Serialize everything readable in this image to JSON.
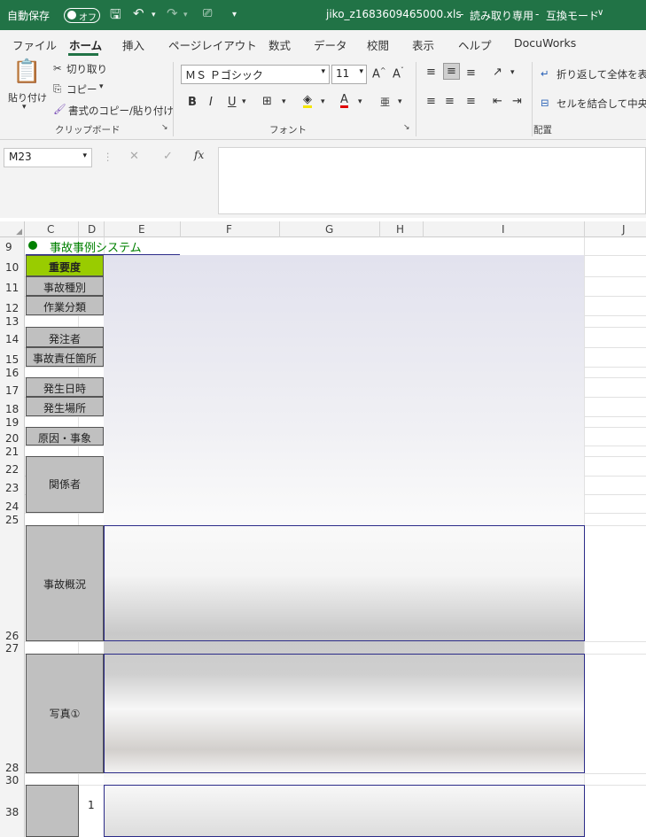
{
  "titlebar": {
    "autosave_label": "自動保存",
    "autosave_state": "オフ",
    "file_title": "jiko_z1683609465000.xls",
    "readonly": "読み取り専用",
    "compat": "互換モード",
    "sep1": "-",
    "sep2": "-",
    "compat_dropdown": "∨"
  },
  "tabs": [
    "ファイル",
    "ホーム",
    "挿入",
    "ページレイアウト",
    "数式",
    "データ",
    "校閲",
    "表示",
    "ヘルプ",
    "DocuWorks"
  ],
  "active_tab": "ホーム",
  "ribbon": {
    "clipboard": {
      "paste": "貼り付け",
      "cut": "切り取り",
      "copy": "コピー",
      "format_painter": "書式のコピー/貼り付け",
      "group": "クリップボード"
    },
    "font": {
      "name": "ＭＳ Ｐゴシック",
      "size": "11",
      "bold": "B",
      "italic": "I",
      "underline": "U",
      "group": "フォント"
    },
    "alignment": {
      "wrap": "折り返して全体を表示",
      "merge": "セルを結合して中央揃",
      "group": "配置"
    }
  },
  "formula_bar": {
    "namebox": "M23",
    "fx": "fx",
    "value": ""
  },
  "columns": [
    "C",
    "D",
    "E",
    "F",
    "G",
    "H",
    "I",
    "J"
  ],
  "rows": [
    "9",
    "10",
    "11",
    "12",
    "13",
    "14",
    "15",
    "16",
    "17",
    "18",
    "19",
    "20",
    "21",
    "22",
    "23",
    "24",
    "25",
    "26",
    "27",
    "28",
    "30",
    "38"
  ],
  "sheet": {
    "title": "事故事例システム",
    "labels": {
      "severity": "重要度",
      "accident_type": "事故種別",
      "work_class": "作業分類",
      "orderer": "発注者",
      "responsible": "事故責任箇所",
      "date": "発生日時",
      "place": "発生場所",
      "cause": "原因・事象",
      "persons": "関係者",
      "summary": "事故概況",
      "photo1": "写真①"
    },
    "row38_num": "1",
    "colors": {
      "severity_fill": "#99cc00",
      "label_fill": "#c0c0c0",
      "title_text": "#008000",
      "border_navy": "#2b2b88",
      "excel_green": "#217346"
    }
  }
}
